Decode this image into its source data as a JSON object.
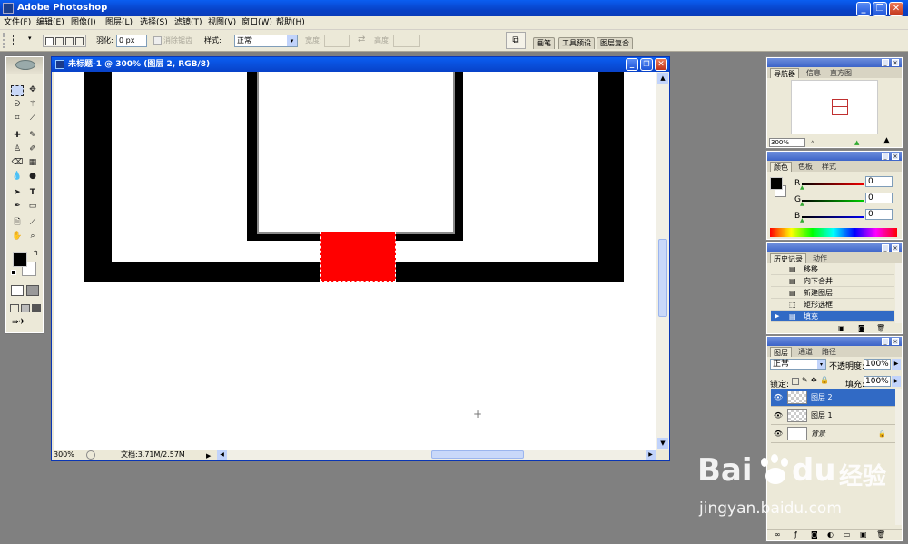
{
  "app": {
    "title": "Adobe Photoshop",
    "window_buttons": [
      "_",
      "❐",
      "✕"
    ]
  },
  "menu": [
    "文件(F)",
    "编辑(E)",
    "图像(I)",
    "图层(L)",
    "选择(S)",
    "滤镜(T)",
    "视图(V)",
    "窗口(W)",
    "帮助(H)"
  ],
  "options": {
    "feather_label": "羽化:",
    "feather_value": "0 px",
    "antialias_label": "消除锯齿",
    "style_label": "样式:",
    "style_value": "正常",
    "width_label": "宽度:",
    "height_label": "高度:",
    "palette_tabs": [
      "画笔",
      "工具预设",
      "图层复合"
    ]
  },
  "document": {
    "title": "未标题-1 @ 300% (图层 2, RGB/8)",
    "zoom": "300%",
    "doc_info": "文档:3.71M/2.57M"
  },
  "navigator": {
    "tabs": [
      "导航器",
      "信息",
      "直方图"
    ],
    "zoom": "300%"
  },
  "color": {
    "tabs": [
      "颜色",
      "色板",
      "样式"
    ],
    "channels": [
      {
        "label": "R",
        "value": "0"
      },
      {
        "label": "G",
        "value": "0"
      },
      {
        "label": "B",
        "value": "0"
      }
    ]
  },
  "history": {
    "tabs": [
      "历史记录",
      "动作"
    ],
    "items": [
      {
        "label": "移移",
        "selected": false
      },
      {
        "label": "向下合并",
        "selected": false
      },
      {
        "label": "新建图层",
        "selected": false
      },
      {
        "label": "矩形选框",
        "selected": false
      },
      {
        "label": "填充",
        "selected": true
      }
    ]
  },
  "layers": {
    "tabs": [
      "图层",
      "通道",
      "路径"
    ],
    "blend_mode": "正常",
    "opacity_label": "不透明度:",
    "opacity_value": "100%",
    "lock_label": "锁定:",
    "fill_label": "填充:",
    "fill_value": "100%",
    "items": [
      {
        "name": "图层 2",
        "selected": true
      },
      {
        "name": "图层 1",
        "selected": false
      },
      {
        "name": "背景",
        "selected": false
      }
    ]
  },
  "watermark": {
    "brand": "Bai",
    "brand_suffix": "du",
    "cn": "经验",
    "url": "jingyan.baidu.com"
  },
  "colors": {
    "xp_blue": "#0a5ef1",
    "fill_red": "#ff0000",
    "selection": "#316ac5"
  }
}
